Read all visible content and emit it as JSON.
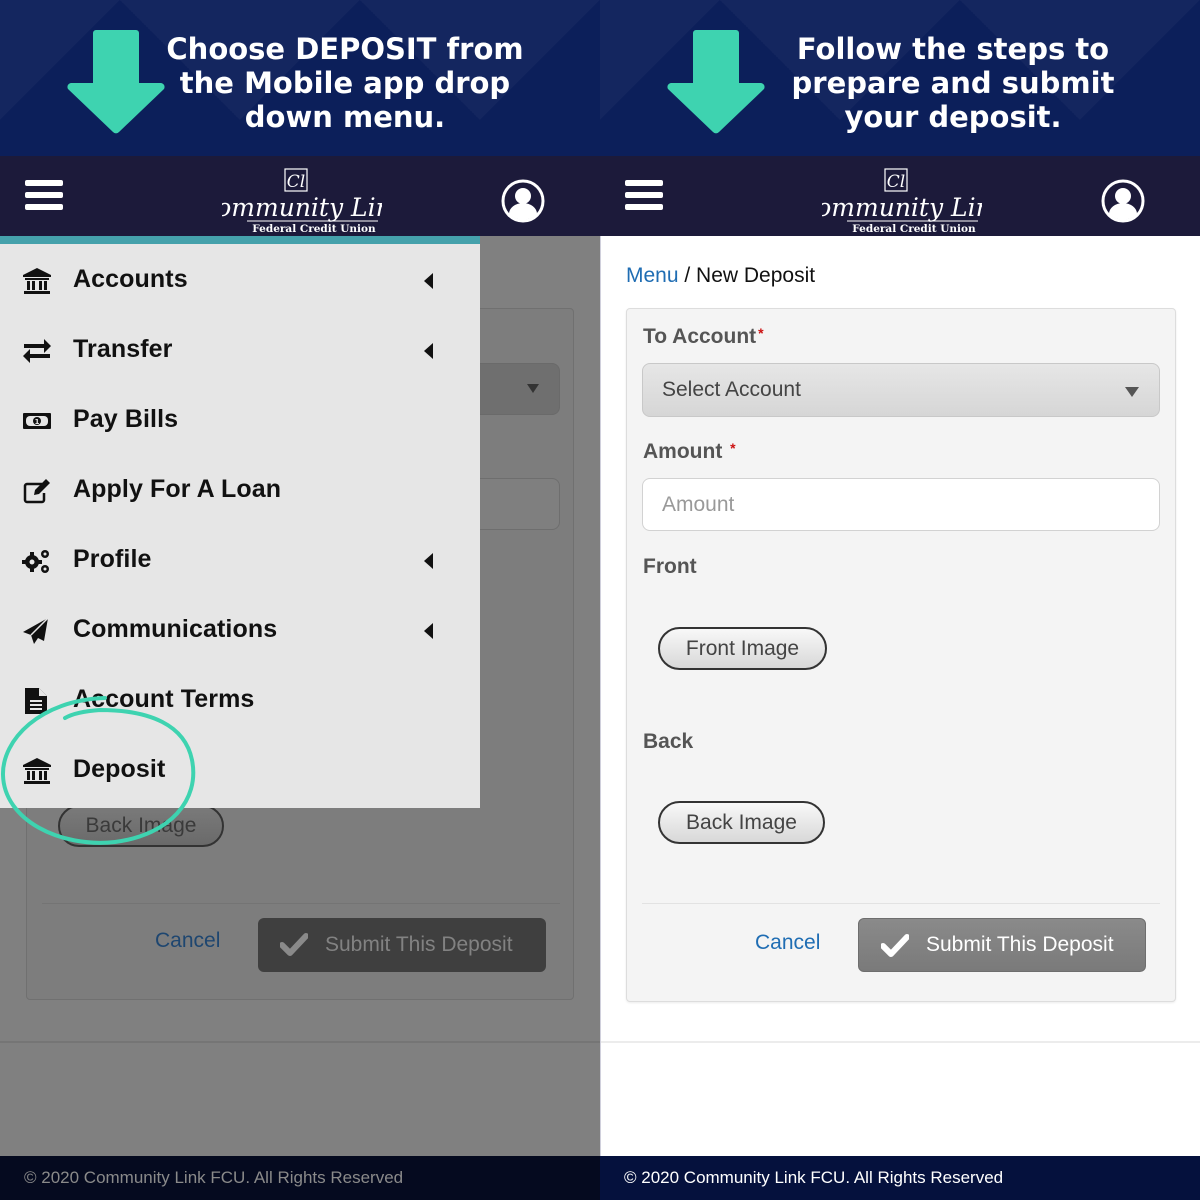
{
  "colors": {
    "banner_bg": "#0c1f5a",
    "arrow": "#3ed3b0",
    "header_bg": "#1c1a3a",
    "menu_accent": "#45a1ab",
    "link": "#1f6db3",
    "required": "#cc1111",
    "footer_bg": "#05113d"
  },
  "left_panel": {
    "banner": {
      "arrow_icon": "down-arrow-icon",
      "lines": [
        "Choose DEPOSIT from",
        "the Mobile app drop",
        "down menu."
      ]
    },
    "header": {
      "menu_icon": "hamburger-icon",
      "logo_name": "Community Link",
      "logo_subtitle": "Federal Credit Union",
      "user_icon": "user-circle-icon"
    },
    "menu": {
      "items": [
        {
          "label": "Accounts",
          "icon": "bank-icon",
          "has_submenu": true
        },
        {
          "label": "Transfer",
          "icon": "transfer-arrows-icon",
          "has_submenu": true
        },
        {
          "label": "Pay Bills",
          "icon": "money-bill-icon",
          "has_submenu": false
        },
        {
          "label": "Apply For A Loan",
          "icon": "edit-icon",
          "has_submenu": false
        },
        {
          "label": "Profile",
          "icon": "gears-icon",
          "has_submenu": true
        },
        {
          "label": "Communications",
          "icon": "paper-plane-icon",
          "has_submenu": true
        },
        {
          "label": "Account Terms",
          "icon": "document-icon",
          "has_submenu": false
        },
        {
          "label": "Deposit",
          "icon": "bank-icon",
          "has_submenu": false,
          "highlighted": true
        }
      ]
    },
    "background_form": {
      "back_image_label": "Back Image",
      "cancel_label": "Cancel",
      "submit_label": "Submit This Deposit"
    },
    "footer": "© 2020 Community Link FCU. All Rights Reserved"
  },
  "right_panel": {
    "banner": {
      "arrow_icon": "down-arrow-icon",
      "lines": [
        "Follow the steps to",
        "prepare and submit",
        "your deposit."
      ]
    },
    "header": {
      "menu_icon": "hamburger-icon",
      "logo_name": "Community Link",
      "logo_subtitle": "Federal Credit Union",
      "user_icon": "user-circle-icon"
    },
    "breadcrumb": {
      "link": "Menu",
      "separator": " / ",
      "current": "New Deposit"
    },
    "form": {
      "to_account_label": "To Account",
      "to_account_value": "Select Account",
      "amount_label": "Amount",
      "amount_placeholder": "Amount",
      "amount_value": "",
      "required_mark": "*",
      "front_label": "Front",
      "front_button": "Front Image",
      "back_label": "Back",
      "back_button": "Back Image",
      "cancel_label": "Cancel",
      "submit_label": "Submit This Deposit"
    },
    "footer": "© 2020 Community Link FCU. All Rights Reserved"
  }
}
